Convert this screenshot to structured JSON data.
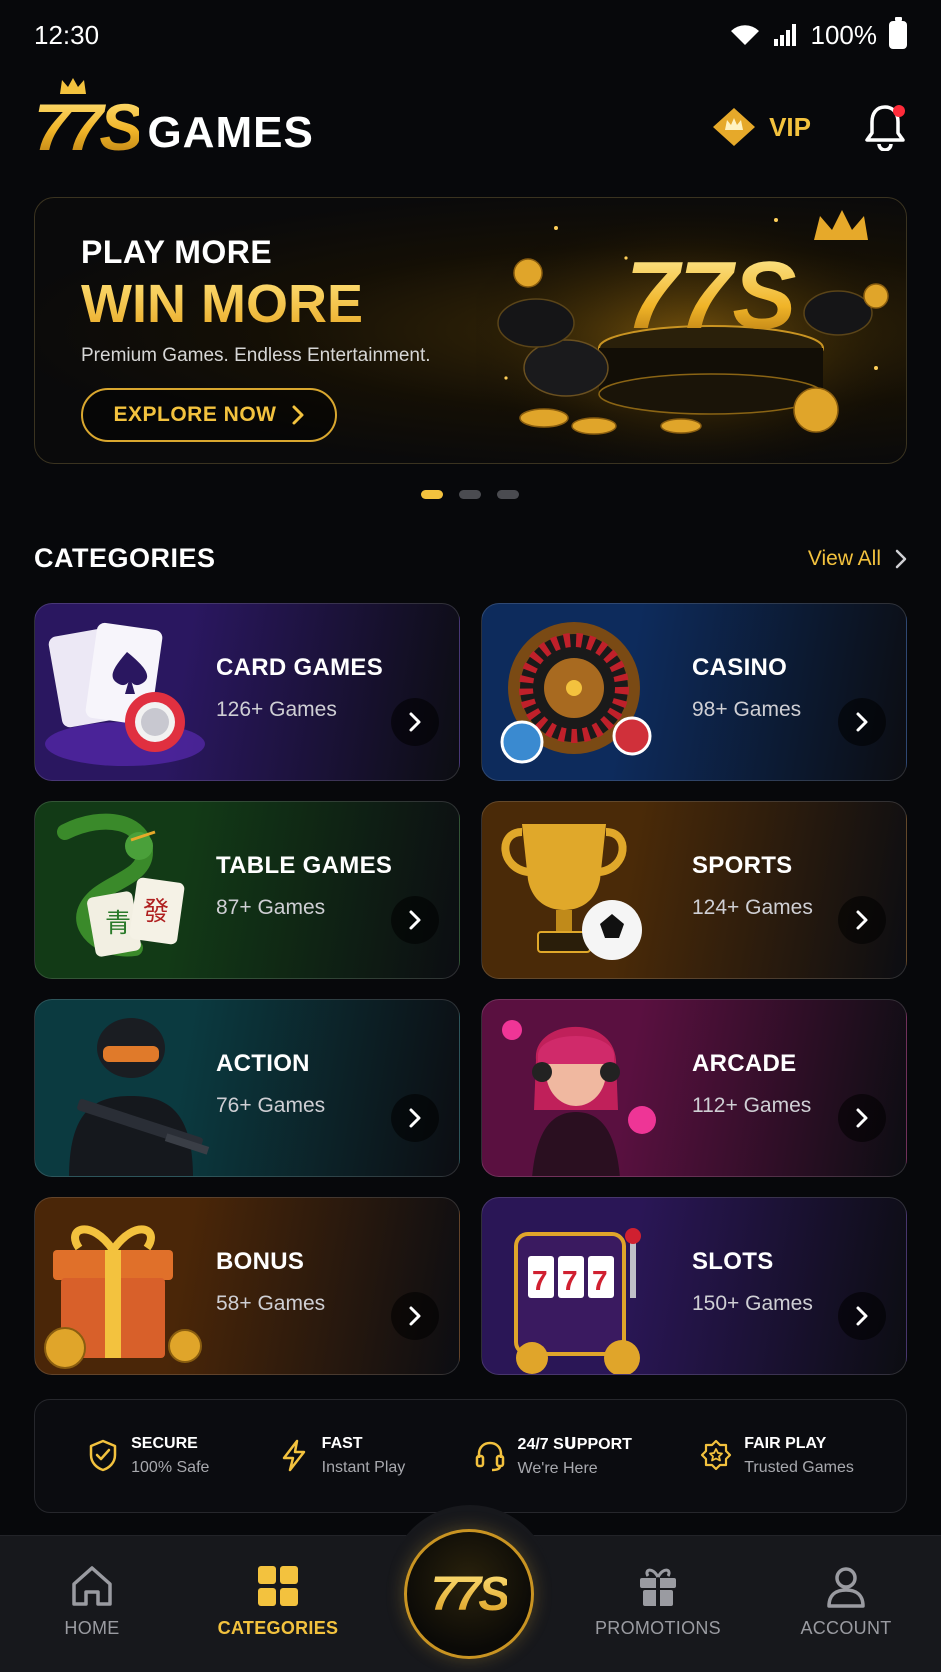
{
  "status_bar": {
    "time": "12:30",
    "battery": "100%"
  },
  "header": {
    "logo_mark": "77S",
    "logo_word": "GAMES",
    "vip_label": "VIP"
  },
  "banner": {
    "line1": "PLAY MORE",
    "line2": "WIN MORE",
    "subtitle": "Premium Games. Endless Entertainment.",
    "cta": "EXPLORE NOW",
    "art_text": "77S",
    "slides": 3,
    "active_slide": 1
  },
  "categories": {
    "title": "CATEGORIES",
    "view_all": "View All",
    "items": [
      {
        "title": "CARD GAMES",
        "count": "126+ Games",
        "icon": "cards-icon",
        "bg": "#2a1760"
      },
      {
        "title": "CASINO",
        "count": "98+ Games",
        "icon": "roulette-icon",
        "bg": "#0d2b5c"
      },
      {
        "title": "TABLE GAMES",
        "count": "87+ Games",
        "icon": "mahjong-dragon-icon",
        "bg": "#123a16"
      },
      {
        "title": "SPORTS",
        "count": "124+ Games",
        "icon": "trophy-icon",
        "bg": "#4a2a08"
      },
      {
        "title": "ACTION",
        "count": "76+ Games",
        "icon": "soldier-icon",
        "bg": "#0b3a40"
      },
      {
        "title": "ARCADE",
        "count": "112+ Games",
        "icon": "gamer-girl-icon",
        "bg": "#5a1040"
      },
      {
        "title": "BONUS",
        "count": "58+ Games",
        "icon": "gift-icon",
        "bg": "#4a2608"
      },
      {
        "title": "SLOTS",
        "count": "150+ Games",
        "icon": "slot-machine-icon",
        "bg": "#2a1656"
      }
    ]
  },
  "features": [
    {
      "title": "SECURE",
      "sub": "100% Safe",
      "icon": "shield-check-icon"
    },
    {
      "title": "FAST",
      "sub": "Instant Play",
      "icon": "lightning-icon"
    },
    {
      "title": "24/7 SᑌPPORT",
      "sub": "We're Here",
      "icon": "headset-icon"
    },
    {
      "title": "FAIR PLAY",
      "sub": "Trusted Games",
      "icon": "star-badge-icon"
    }
  ],
  "nav": {
    "items": [
      {
        "label": "HOME",
        "icon": "home-icon"
      },
      {
        "label": "CATEGORIES",
        "icon": "grid-icon",
        "active": true
      },
      {
        "label": "77S",
        "icon": "center-logo"
      },
      {
        "label": "PROMOTIONS",
        "icon": "gift-icon"
      },
      {
        "label": "ACCOUNT",
        "icon": "user-icon"
      }
    ]
  },
  "colors": {
    "accent": "#f3c23e",
    "background": "#07080b",
    "nav_bg": "#17181c"
  }
}
